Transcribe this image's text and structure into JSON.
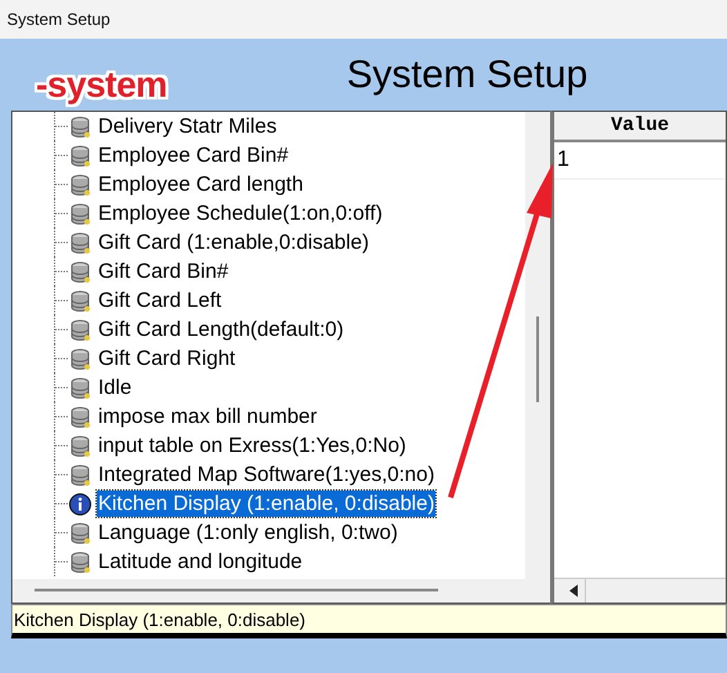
{
  "window": {
    "title": "System Setup"
  },
  "header": {
    "title": "System Setup"
  },
  "annotation": {
    "label": "-system",
    "kind": "arrow"
  },
  "tree": {
    "items": [
      {
        "label": "Delivery Statr Miles",
        "kind": "setting",
        "selected": false
      },
      {
        "label": "Employee Card Bin#",
        "kind": "setting",
        "selected": false
      },
      {
        "label": "Employee Card length",
        "kind": "setting",
        "selected": false
      },
      {
        "label": "Employee Schedule(1:on,0:off)",
        "kind": "setting",
        "selected": false
      },
      {
        "label": "Gift Card (1:enable,0:disable)",
        "kind": "setting",
        "selected": false
      },
      {
        "label": "Gift Card Bin#",
        "kind": "setting",
        "selected": false
      },
      {
        "label": "Gift Card Left",
        "kind": "setting",
        "selected": false
      },
      {
        "label": "Gift Card Length(default:0)",
        "kind": "setting",
        "selected": false
      },
      {
        "label": "Gift Card Right",
        "kind": "setting",
        "selected": false
      },
      {
        "label": "Idle",
        "kind": "setting",
        "selected": false
      },
      {
        "label": "impose max bill number",
        "kind": "setting",
        "selected": false
      },
      {
        "label": "input table on Exress(1:Yes,0:No)",
        "kind": "setting",
        "selected": false
      },
      {
        "label": "Integrated Map Software(1:yes,0:no)",
        "kind": "setting",
        "selected": false
      },
      {
        "label": "Kitchen Display (1:enable, 0:disable)",
        "kind": "info",
        "selected": true
      },
      {
        "label": "Language (1:only english, 0:two)",
        "kind": "setting",
        "selected": false
      },
      {
        "label": "Latitude and longitude",
        "kind": "setting",
        "selected": false
      }
    ]
  },
  "value_table": {
    "columns": [
      "Value"
    ],
    "rows": [
      [
        "1"
      ]
    ]
  },
  "status_bar": {
    "text": "Kitchen Display (1:enable, 0:disable)"
  }
}
